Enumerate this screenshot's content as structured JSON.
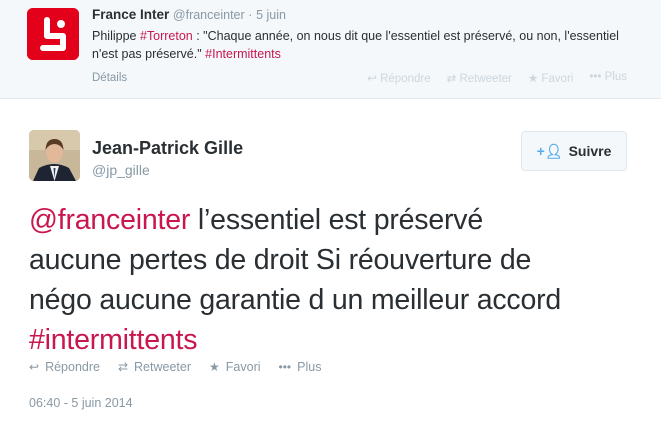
{
  "parent_tweet": {
    "name": "France Inter",
    "handle": "@franceinter",
    "separator": "·",
    "date": "5 juin",
    "text_before": "Philippe ",
    "hashtag1": "#Torreton",
    "text_mid": " : \"Chaque année, on nous dit que l'essentiel est préservé, ou non, l'essentiel n'est pas préservé.\" ",
    "hashtag2": "#Intermittents",
    "details_label": "Détails",
    "actions": {
      "reply": "Répondre",
      "retweet": "Retweeter",
      "favorite": "Favori",
      "more": "Plus"
    }
  },
  "main_tweet": {
    "name": "Jean-Patrick Gille",
    "handle": "@jp_gille",
    "follow_label": "Suivre",
    "text": {
      "mention": "@franceinter",
      "line1_rest": " l’essentiel est préservé",
      "line2": "aucune pertes de droit Si réouverture de",
      "line3": "négo aucune garantie d un meilleur accord",
      "hashtag": "#intermittents"
    },
    "actions": {
      "reply": "Répondre",
      "retweet": "Retweeter",
      "favorite": "Favori",
      "more": "Plus"
    },
    "timestamp": "06:40 - 5 juin 2014"
  },
  "colors": {
    "hashtag": "#c8174f",
    "france_inter_red": "#e2001a",
    "muted": "#8899a6"
  }
}
